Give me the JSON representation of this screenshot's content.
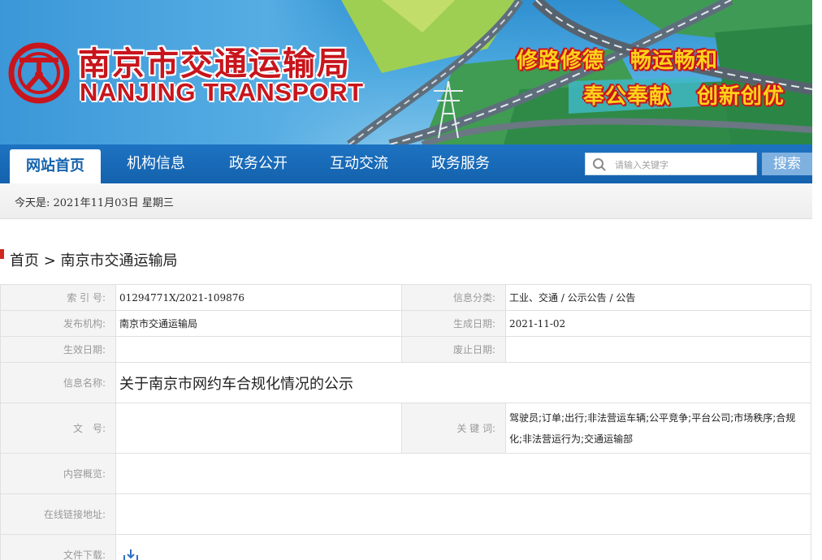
{
  "header": {
    "title_cn": "南京市交通运输局",
    "title_en": "NANJING TRANSPORT",
    "slogans": [
      "修路修德",
      "畅运畅和",
      "奉公奉献",
      "创新创优"
    ],
    "colors": {
      "brand_red": "#c8151c",
      "slogan_yellow": "#ffd21a",
      "nav_blue": "#1462ad"
    }
  },
  "nav": {
    "items": [
      {
        "label": "网站首页",
        "active": true
      },
      {
        "label": "机构信息"
      },
      {
        "label": "政务公开"
      },
      {
        "label": "互动交流"
      },
      {
        "label": "政务服务"
      }
    ],
    "search_placeholder": "请输入关键字",
    "search_button": "搜索"
  },
  "date_text": "今天是: 2021年11月03日 星期三",
  "breadcrumb": "首页 > 南京市交通运输局",
  "info": {
    "index_label": "索 引 号:",
    "index_value": "01294771X/2021-109876",
    "category_label": "信息分类:",
    "category_value": "工业、交通 / 公示公告 / 公告",
    "publisher_label": "发布机构:",
    "publisher_value": "南京市交通运输局",
    "created_label": "生成日期:",
    "created_value": "2021-11-02",
    "effective_label": "生效日期:",
    "effective_value": "",
    "abolished_label": "废止日期:",
    "abolished_value": "",
    "name_label": "信息名称:",
    "name_value": "关于南京市网约车合规化情况的公示",
    "docno_label": "文　号:",
    "docno_value": "",
    "keywords_label": "关 键 词:",
    "keywords_value": "驾驶员;订单;出行;非法营运车辆;公平竞争;平台公司;市场秩序;合规化;非法营运行为;交通运输部",
    "summary_label": "内容概览:",
    "summary_value": "",
    "link_label": "在线链接地址:",
    "link_value": "",
    "download_label": "文件下载:",
    "download_icon": "download-icon"
  }
}
